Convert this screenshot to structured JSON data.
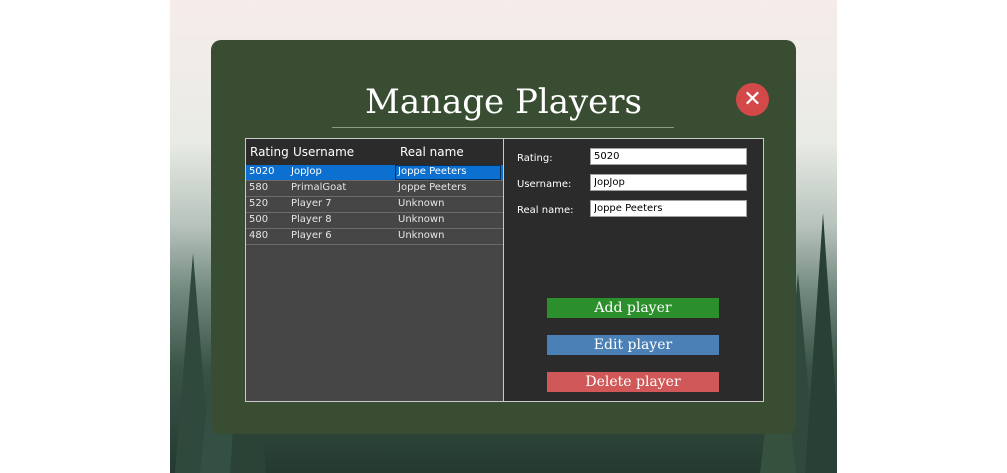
{
  "dialog": {
    "title": "Manage Players",
    "close_icon": "close-icon"
  },
  "list": {
    "columns": [
      "Rating",
      "Username",
      "Real name"
    ],
    "rows": [
      {
        "rating": "5020",
        "username": "JopJop",
        "realname": "Joppe Peeters",
        "selected": true
      },
      {
        "rating": "580",
        "username": "PrimalGoat",
        "realname": "Joppe Peeters"
      },
      {
        "rating": "520",
        "username": "Player 7",
        "realname": "Unknown"
      },
      {
        "rating": "500",
        "username": "Player 8",
        "realname": "Unknown"
      },
      {
        "rating": "480",
        "username": "Player 6",
        "realname": "Unknown"
      }
    ]
  },
  "form": {
    "rating_label": "Rating:",
    "rating_value": "5020",
    "username_label": "Username:",
    "username_value": "JopJop",
    "realname_label": "Real name:",
    "realname_value": "Joppe Peeters"
  },
  "buttons": {
    "add": "Add player",
    "edit": "Edit player",
    "delete": "Delete player"
  },
  "colors": {
    "dialog_bg": "#384d32",
    "selection": "#0b70d0",
    "add": "#2b8f2b",
    "edit": "#4a80b5",
    "delete": "#d05858"
  }
}
